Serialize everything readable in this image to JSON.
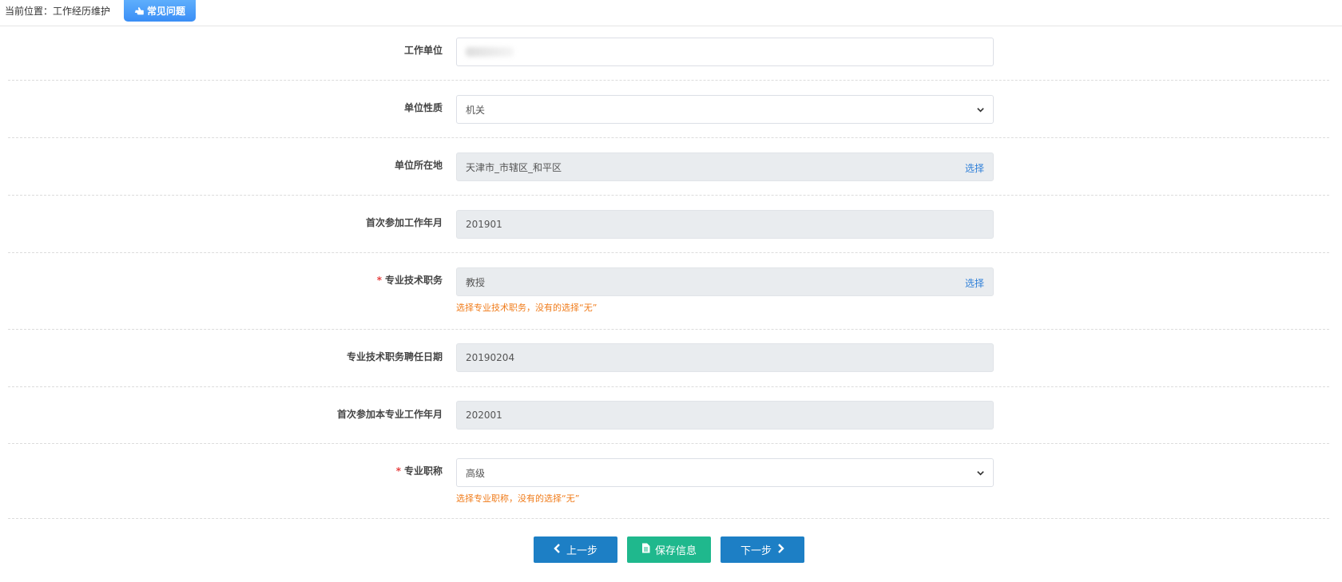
{
  "header": {
    "breadcrumb_prefix": "当前位置：",
    "breadcrumb_current": "工作经历维护",
    "faq_label": "常见问题"
  },
  "form": {
    "employer": {
      "label": "工作单位",
      "value": ""
    },
    "employer_type": {
      "label": "单位性质",
      "value": "机关"
    },
    "employer_location": {
      "label": "单位所在地",
      "value": "天津市_市辖区_和平区",
      "action": "选择"
    },
    "first_work_month": {
      "label": "首次参加工作年月",
      "value": "201901"
    },
    "tech_position": {
      "required_mark": "*",
      "label": "专业技术职务",
      "value": "教授",
      "action": "选择",
      "hint": "选择专业技术职务，没有的选择“无”"
    },
    "tech_position_date": {
      "label": "专业技术职务聘任日期",
      "value": "20190204"
    },
    "first_professional_month": {
      "label": "首次参加本专业工作年月",
      "value": "202001"
    },
    "professional_title": {
      "required_mark": "*",
      "label": "专业职称",
      "value": "高级",
      "hint": "选择专业职称，没有的选择“无”"
    }
  },
  "actions": {
    "prev_label": "上一步",
    "save_label": "保存信息",
    "next_label": "下一步"
  },
  "colors": {
    "primary_button": "#1d7fc5",
    "save_button": "#1fb88d",
    "hint_text": "#f07c1b",
    "link": "#2f7fd8",
    "required": "#e64242"
  }
}
